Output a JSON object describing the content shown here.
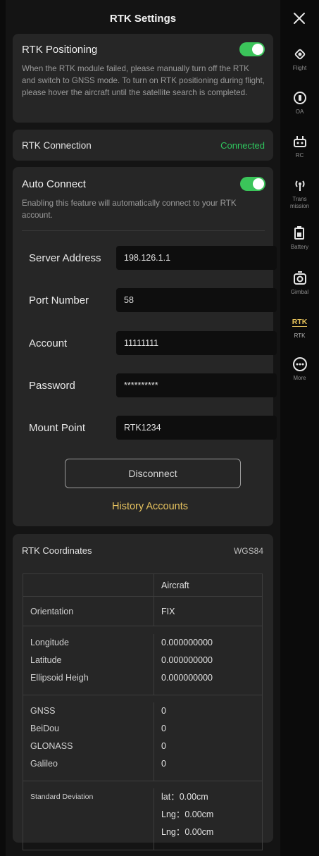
{
  "header": {
    "title": "RTK Settings"
  },
  "rtk_positioning": {
    "label": "RTK Positioning",
    "enabled": true,
    "description": "When the RTK module failed, please manually turn off the RTK and switch to GNSS mode. To turn on RTK positioning during flight, please hover the aircraft until the satellite search is completed."
  },
  "rtk_connection": {
    "label": "RTK Connection",
    "status": "Connected",
    "status_color": "#2fc65e"
  },
  "auto_connect": {
    "label": "Auto Connect",
    "enabled": true,
    "description": "Enabling this feature will automatically connect to your RTK account."
  },
  "fields": {
    "server": {
      "label": "Server Address",
      "value": "198.126.1.1"
    },
    "port": {
      "label": "Port Number",
      "value": "58"
    },
    "account": {
      "label": "Account",
      "value": "11111111"
    },
    "password": {
      "label": "Password",
      "value": "**********"
    },
    "mount": {
      "label": "Mount Point",
      "value": "RTK1234"
    }
  },
  "actions": {
    "disconnect": "Disconnect",
    "history": "History Accounts"
  },
  "coordinates": {
    "title": "RTK Coordinates",
    "system": "WGS84",
    "column_header": "Aircraft",
    "orientation": {
      "label": "Orientation",
      "value": "FIX"
    },
    "position": [
      {
        "label": "Longitude",
        "value": "0.000000000"
      },
      {
        "label": "Latitude",
        "value": "0.000000000"
      },
      {
        "label": "Ellipsoid Heigh",
        "value": "0.000000000"
      }
    ],
    "satellites": [
      {
        "label": "GNSS",
        "value": "0"
      },
      {
        "label": "BeiDou",
        "value": "0"
      },
      {
        "label": "GLONASS",
        "value": "0"
      },
      {
        "label": "Galileo",
        "value": "0"
      }
    ],
    "deviation": {
      "label": "Standard Deviation",
      "values": [
        "lat：0.00cm",
        "Lng：0.00cm",
        "Lng：0.00cm"
      ]
    }
  },
  "sidebar": {
    "items": [
      {
        "label": "Flight",
        "icon": "flight-icon"
      },
      {
        "label": "OA",
        "icon": "obstacle-avoidance-icon"
      },
      {
        "label": "RC",
        "icon": "remote-controller-icon"
      },
      {
        "label": "Trans\nmission",
        "icon": "transmission-icon"
      },
      {
        "label": "Battery",
        "icon": "battery-icon"
      },
      {
        "label": "Gimbal",
        "icon": "gimbal-icon"
      },
      {
        "label": "RTK",
        "icon": "rtk-icon",
        "badge": "RTK"
      },
      {
        "label": "More",
        "icon": "more-icon"
      }
    ]
  },
  "colors": {
    "accent_green": "#3bc45a",
    "history_gold": "#e7c35f",
    "rtk_badge": "#e5c15a"
  }
}
